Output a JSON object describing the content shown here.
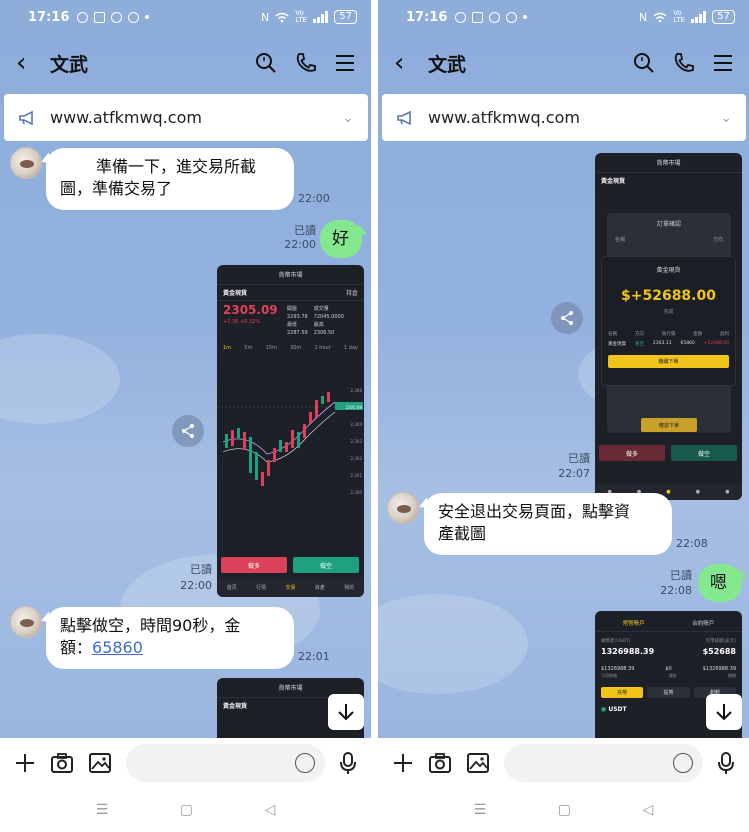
{
  "status": {
    "time": "17:16",
    "battery": "57",
    "network": "Vo LTE"
  },
  "chat": {
    "contact_name": "文武",
    "notice_url": "www.atfkmwq.com"
  },
  "left": {
    "messages": [
      {
        "text": "準備一下，進交易所截圖，準備交易了",
        "line1": "準備一下，進交易所截",
        "line2": "圖，準備交易了",
        "time": "22:00"
      },
      {
        "text": "好",
        "read": "已讀",
        "time": "22:00"
      },
      {
        "read": "已讀",
        "time": "22:00"
      },
      {
        "line1": "點擊做空，時間90秒，金",
        "line2_prefix": "額：",
        "amount": "65860",
        "time": "22:01"
      }
    ],
    "screenshot": {
      "title": "貨幣市場",
      "asset": "黃金現貨",
      "fav": "持倉",
      "price": "2305.09",
      "change": "+7.36 +0.32%",
      "stats": [
        {
          "label": "開盤",
          "value": "2293.78"
        },
        {
          "label": "最低",
          "value": "2287.59"
        },
        {
          "label": "成交量",
          "value": "72045.0000"
        },
        {
          "label": "最高",
          "value": "2306.50"
        }
      ],
      "tabs": [
        "1m",
        "5m",
        "15m",
        "30m",
        "1 hour",
        "1 day"
      ],
      "y_ticks": [
        "2,306",
        "2,305",
        "2,304",
        "2,303",
        "2,302",
        "2,301",
        "2,300"
      ],
      "current_tick": "2305.09",
      "sell_label": "做多",
      "buy_label": "做空",
      "nav": [
        "首頁",
        "行情",
        "交易",
        "資產",
        "我的"
      ]
    },
    "screenshot2": {
      "title": "貨幣市場",
      "asset": "黃金現貨"
    }
  },
  "right": {
    "messages": [
      {
        "read": "已讀",
        "time": "22:07"
      },
      {
        "line1": "安全退出交易頁面，點擊資",
        "line2": "產截圖",
        "time": "22:08"
      },
      {
        "text": "嗯",
        "read": "已讀",
        "time": "22:08"
      }
    ],
    "screenshot": {
      "title": "貨幣市場",
      "asset": "黃金現貨",
      "modal_title": "訂單確認",
      "modal_cols": [
        "名稱",
        "方向"
      ],
      "result_title": "黃金現貨",
      "profit": "$+52688.00",
      "result_sub": "完成",
      "table_headers": [
        "名稱",
        "方向",
        "執行價",
        "金額",
        "盈利"
      ],
      "table_row": [
        "黃金現貨",
        "看空",
        "2303.13",
        "65860",
        "+52688.00"
      ],
      "continue_label": "繼續下單",
      "confirm_label": "確認下單",
      "buy": "做多",
      "sell": "做空"
    },
    "screenshot2": {
      "tabs": [
        "幣幣賬戶",
        "合約賬戶"
      ],
      "label1": "總資產(USDT)",
      "label2": "可用餘額(美元)",
      "total": "1326988.39",
      "right_total": "$52688",
      "sub_values": [
        "$1326988.39",
        "$0",
        "$1326988.39"
      ],
      "sub_labels": [
        "可用餘額",
        "凍結",
        "總額"
      ],
      "buttons": [
        "充幣",
        "提幣",
        "劃轉"
      ],
      "coin": "USDT"
    }
  },
  "colors": {
    "chat_bg": "#8eaddc",
    "bubble_green": "#84e98e",
    "link": "#3b6fc9",
    "up": "#1fa07f",
    "down": "#d9425a",
    "gold": "#f0c419"
  }
}
